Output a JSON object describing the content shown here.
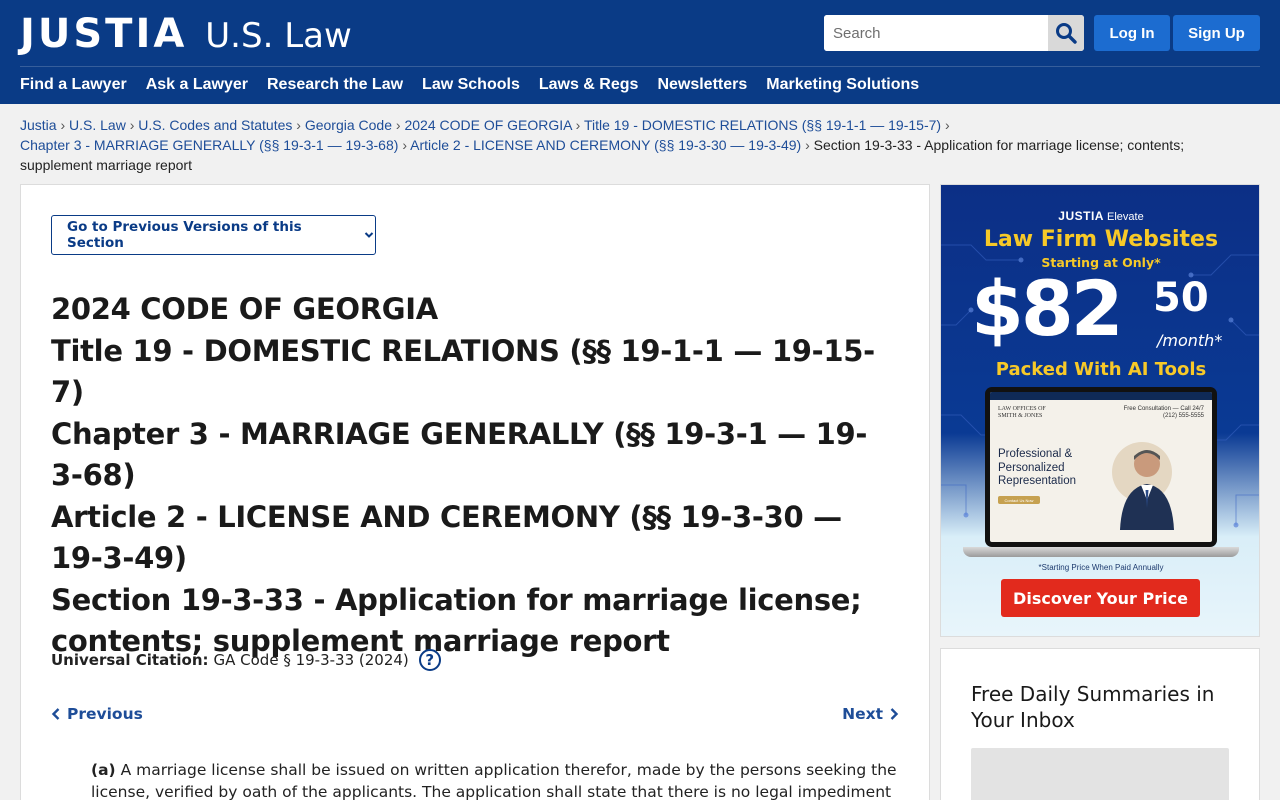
{
  "header": {
    "logo_main": "JUSTIA",
    "logo_sub": "U.S. Law",
    "search_placeholder": "Search",
    "login_label": "Log In",
    "signup_label": "Sign Up",
    "nav": [
      "Find a Lawyer",
      "Ask a Lawyer",
      "Research the Law",
      "Law Schools",
      "Laws & Regs",
      "Newsletters",
      "Marketing Solutions"
    ]
  },
  "breadcrumb": {
    "links": [
      "Justia",
      "U.S. Law",
      "U.S. Codes and Statutes",
      "Georgia Code",
      "2024 CODE OF GEORGIA",
      "Title 19 - DOMESTIC RELATIONS (§§ 19-1-1 — 19-15-7)",
      "Chapter 3 - MARRIAGE GENERALLY (§§ 19-3-1 — 19-3-68)",
      "Article 2 - LICENSE AND CEREMONY (§§ 19-3-30 — 19-3-49)"
    ],
    "separator": "›",
    "current": "Section 19-3-33 - Application for marriage license; contents; supplement marriage report"
  },
  "main": {
    "versions_button": "Go to Previous Versions of this Section",
    "titles": [
      "2024 CODE OF GEORGIA",
      "Title 19 - DOMESTIC RELATIONS (§§ 19-1-1 — 19-15-7)",
      "Chapter 3 - MARRIAGE GENERALLY (§§ 19-3-1 — 19-3-68)",
      "Article 2 - LICENSE AND CEREMONY (§§ 19-3-30 — 19-3-49)",
      "Section 19-3-33 - Application for marriage license; contents; supplement marriage report"
    ],
    "citation_label": "Universal Citation:",
    "citation_value": "GA Code § 19-3-33 (2024)",
    "help_glyph": "?",
    "prev_label": "Previous",
    "next_label": "Next",
    "paragraph_label": "(a)",
    "paragraph_text": "A marriage license shall be issued on written application therefor, made by the persons seeking the license, verified by oath of the applicants. The application shall state that there is no legal impediment to the"
  },
  "ad": {
    "brand": "JUSTIA",
    "brand_sub": "Elevate",
    "headline": "Law Firm Websites",
    "starting": "Starting at Only*",
    "price_dollars": "$82",
    "price_cents": "50",
    "per": "/month*",
    "tagline": "Packed With AI Tools",
    "screen_firm": "LAW OFFICES OF\nSMITH & JONES",
    "screen_phone": "Free Consultation — Call 24/7\n(212) 555-5555",
    "screen_headline": "Professional & Personalized Representation",
    "screen_cta": "Contact Us Now",
    "fine_print": "*Starting Price When Paid Annually",
    "cta": "Discover Your Price"
  },
  "newsletter": {
    "title": "Free Daily Summaries in Your Inbox"
  },
  "colors": {
    "brand_navy": "#0a3b86",
    "button_blue": "#1c6cd0",
    "link_blue": "#1e4d98",
    "ad_yellow": "#f7c928",
    "ad_red": "#e22a1d"
  }
}
